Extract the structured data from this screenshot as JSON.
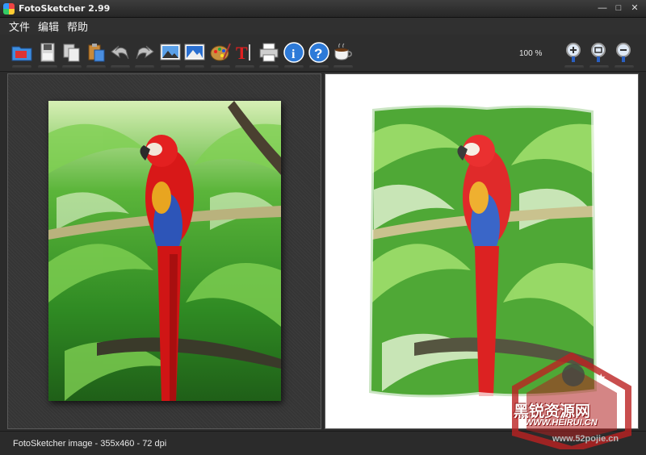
{
  "window": {
    "title": "FotoSketcher 2.99"
  },
  "menu": {
    "items": [
      "文件",
      "编辑",
      "帮助"
    ]
  },
  "toolbar": {
    "buttons": [
      {
        "name": "open-folder-icon"
      },
      {
        "name": "save-icon"
      },
      {
        "name": "copy-icon"
      },
      {
        "name": "paste-icon"
      },
      {
        "name": "undo-icon"
      },
      {
        "name": "redo-icon"
      },
      {
        "name": "original-image-icon"
      },
      {
        "name": "result-image-icon"
      },
      {
        "name": "palette-icon"
      },
      {
        "name": "text-tool-icon"
      },
      {
        "name": "print-icon"
      },
      {
        "name": "info-icon"
      },
      {
        "name": "help-icon"
      },
      {
        "name": "coffee-icon"
      },
      {
        "name": "zoom-in-icon"
      },
      {
        "name": "zoom-fit-icon"
      },
      {
        "name": "zoom-out-icon"
      }
    ],
    "zoom_label": "100 %"
  },
  "status": {
    "text": "FotoSketcher image - 355x460 - 72 dpi"
  },
  "watermark": {
    "line1": "黑锐资源网",
    "line2": "WWW.HEIRUI.CN",
    "line3": "www.52pojie.cn"
  },
  "colors": {
    "accent": "#1e6fd0",
    "parrot_red": "#d81818",
    "foliage": "#3c9a2c"
  }
}
